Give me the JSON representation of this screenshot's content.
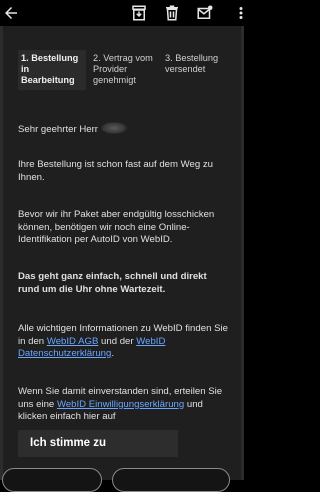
{
  "toolbar": {
    "icons": [
      "back-arrow-icon",
      "archive-icon",
      "delete-icon",
      "mark-unread-icon",
      "more-icon"
    ]
  },
  "steps": [
    {
      "label": "1. Bestellung in Bearbeitung",
      "active": true
    },
    {
      "label": "2. Vertrag vom Provider genehmigt",
      "active": false
    },
    {
      "label": "3. Bestellung versendet",
      "active": false
    }
  ],
  "body": {
    "greeting": "Sehr geehrter Herr",
    "p1": "Ihre Bestellung ist schon fast auf dem Weg zu Ihnen.",
    "p2": "Bevor wir ihr Paket aber endgültig losschicken können, benötigen wir noch eine Online-Identifikation per AutoID von WebID.",
    "p3": "Das geht ganz einfach, schnell und direkt rund um die Uhr ohne Wartezeit.",
    "p4_before": "Alle wichtigen Informationen zu WebID finden Sie in den ",
    "p4_link1": "WebID AGB",
    "p4_middle": " und der ",
    "p4_link2": "WebID Datenschutzerklärung",
    "p4_after": ".",
    "p5_before": "Wenn Sie damit einverstanden sind, erteilen Sie uns eine ",
    "p5_link": "WebID Einwilligungserklärung",
    "p5_after": " und klicken einfach hier auf"
  },
  "agree_button": "Ich stimme zu"
}
